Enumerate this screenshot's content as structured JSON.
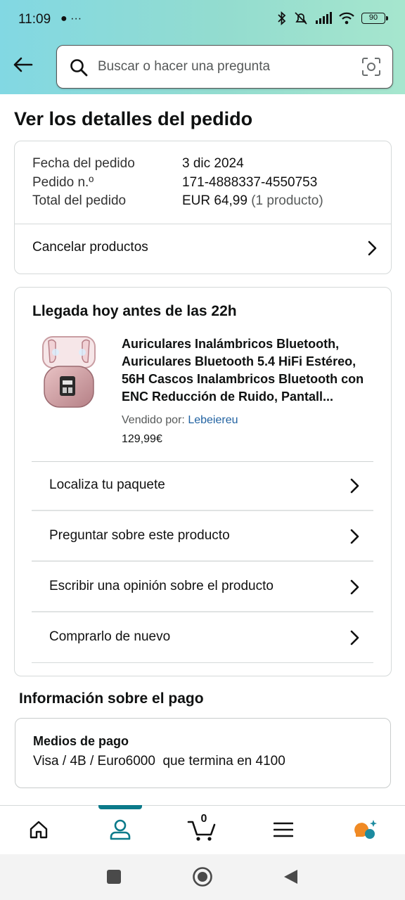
{
  "status_bar": {
    "time": "11:09",
    "battery": "90"
  },
  "search": {
    "placeholder": "Buscar o hacer una pregunta"
  },
  "page": {
    "title": "Ver los detalles del pedido"
  },
  "order": {
    "date_label": "Fecha del pedido",
    "date_value": "3 dic 2024",
    "number_label": "Pedido n.º",
    "number_value": "171-4888337-4550753",
    "total_label": "Total del pedido",
    "total_value": "EUR 64,99",
    "total_count": "(1 producto)",
    "cancel_label": "Cancelar productos"
  },
  "shipment": {
    "delivery": "Llegada hoy antes de las 22h",
    "product_title": "Auriculares Inalámbricos Bluetooth, Auriculares Bluetooth 5.4 HiFi Estéreo, 56H Cascos Inalambricos Bluetooth con ENC Reducción de Ruido, Pantall...",
    "seller_label": "Vendido por:",
    "seller_name": "Lebeiereu",
    "price": "129,99€",
    "actions": [
      {
        "label": "Localiza tu paquete"
      },
      {
        "label": "Preguntar sobre este producto"
      },
      {
        "label": "Escribir una opinión sobre el producto"
      },
      {
        "label": "Comprarlo de nuevo"
      }
    ]
  },
  "payment": {
    "section_title": "Información sobre el pago",
    "methods_title": "Medios de pago",
    "methods_value": "Visa / 4B / Euro6000  que termina en 4100"
  },
  "bottom_nav": {
    "cart_count": "0",
    "active": "profile"
  },
  "colors": {
    "accent": "#0b7a8a",
    "link": "#2162a1",
    "header_start": "#82d8e3",
    "header_end": "#a6e6ce"
  }
}
